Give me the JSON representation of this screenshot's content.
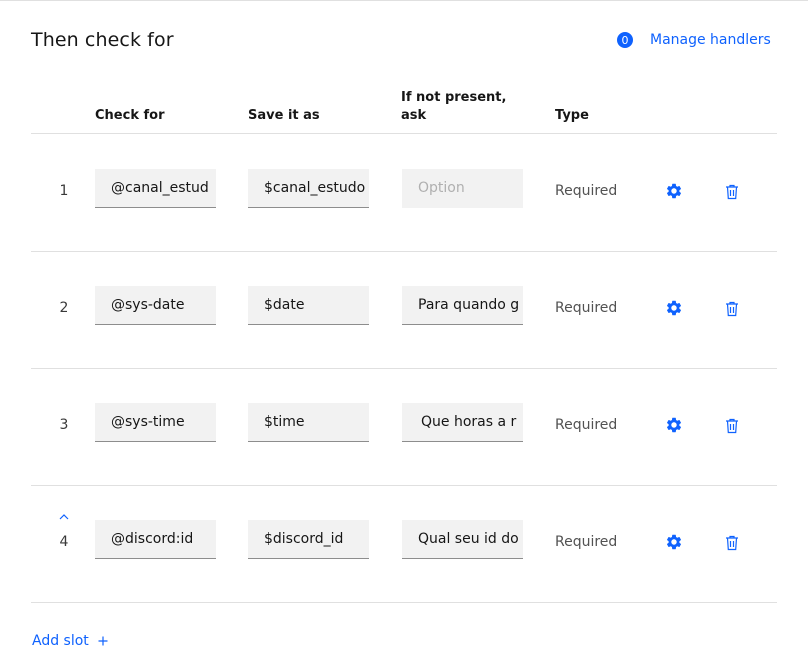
{
  "section": {
    "title": "Then check for",
    "handlers_count": "0",
    "handlers_label": "Manage handlers"
  },
  "columns": {
    "check_for": "Check for",
    "save_as": "Save it as",
    "if_not_present_line1": "If not present,",
    "if_not_present_line2": "ask",
    "type": "Type"
  },
  "rows": [
    {
      "num": "1",
      "check": "@canal_estud",
      "save": "$canal_estudo",
      "ask": "",
      "ask_placeholder": "Option",
      "type": "Required"
    },
    {
      "num": "2",
      "check": "@sys-date",
      "save": "$date",
      "ask": "Para quando g",
      "type": "Required"
    },
    {
      "num": "3",
      "check": "@sys-time",
      "save": "$time",
      "ask": "Que horas a r",
      "type": "Required"
    },
    {
      "num": "4",
      "check": "@discord:id",
      "save": "$discord_id",
      "ask": "Qual seu id do",
      "type": "Required"
    }
  ],
  "add_slot": {
    "label": "Add slot",
    "icon": "plus-icon"
  },
  "colors": {
    "accent": "#0f62fe",
    "field_bg": "#f2f2f2",
    "divider": "#e0e0e0"
  }
}
